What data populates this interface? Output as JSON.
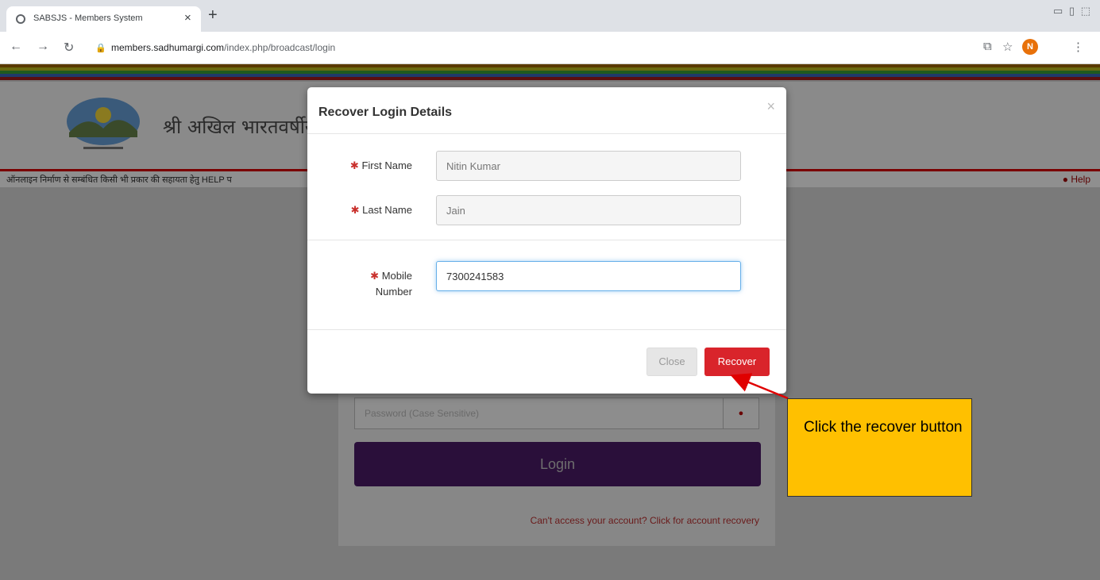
{
  "browser": {
    "tab_title": "SABSJS - Members System",
    "tab_close": "×",
    "new_tab": "+",
    "window_controls": "▭ ▯ ⬚",
    "url_domain": "members.sadhumargi.com",
    "url_path": "/index.php/broadcast/login",
    "profile_initial": "N"
  },
  "header": {
    "site_title": "श्री अखिल भारतवर्षीय",
    "notice_text": "ऑनलाइन निर्माण से सम्बंधित किसी भी प्रकार की सहायता हेतु HELP प",
    "help_label": "Help",
    "stripe_colors": [
      "#7a5a10",
      "#6a6a10",
      "#1f5a1f",
      "#1f3a6a",
      "#6a1010"
    ]
  },
  "login": {
    "password_placeholder": "Password (Case Sensitive)",
    "login_button": "Login",
    "recovery_link": "Can't access your account? Click for account recovery"
  },
  "modal": {
    "title": "Recover Login Details",
    "close_x": "×",
    "fields": {
      "first_name": {
        "label": "First Name",
        "value": "Nitin Kumar"
      },
      "last_name": {
        "label": "Last Name",
        "value": "Jain"
      },
      "mobile": {
        "label_line1": "Mobile",
        "label_line2": "Number",
        "value": "7300241583"
      }
    },
    "required_mark": "✱",
    "close_button": "Close",
    "recover_button": "Recover"
  },
  "annotation": {
    "text": "Click the recover button",
    "bg_color": "#ffc000",
    "arrow_color": "#e00000"
  }
}
